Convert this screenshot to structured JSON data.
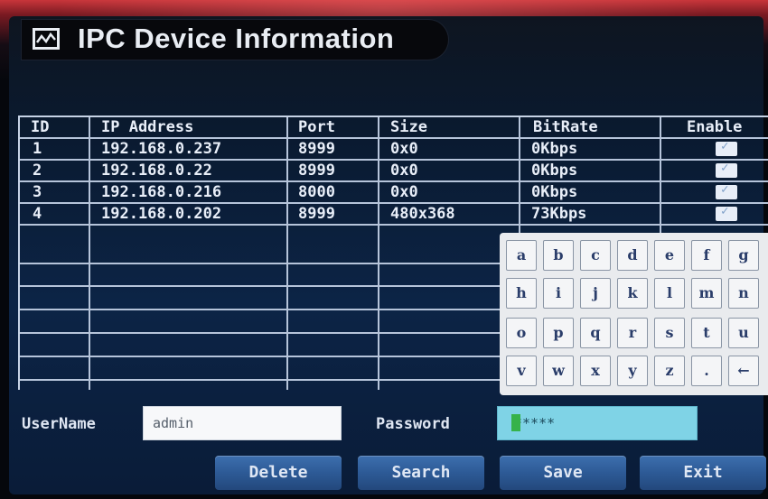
{
  "window": {
    "title": "IPC Device Information"
  },
  "table": {
    "columns": [
      "ID",
      "IP Address",
      "Port",
      "Size",
      "BitRate",
      "Enable"
    ],
    "rows": [
      {
        "id": "1",
        "ip": "192.168.0.237",
        "port": "8999",
        "size": "0x0",
        "bitrate": "0Kbps",
        "enabled": true
      },
      {
        "id": "2",
        "ip": "192.168.0.22",
        "port": "8999",
        "size": "0x0",
        "bitrate": "0Kbps",
        "enabled": true
      },
      {
        "id": "3",
        "ip": "192.168.0.216",
        "port": "8000",
        "size": "0x0",
        "bitrate": "0Kbps",
        "enabled": true
      },
      {
        "id": "4",
        "ip": "192.168.0.202",
        "port": "8999",
        "size": "480x368",
        "bitrate": "73Kbps",
        "enabled": true
      }
    ]
  },
  "keyboard": {
    "keys": [
      [
        "a",
        "b",
        "c",
        "d",
        "e",
        "f",
        "g"
      ],
      [
        "h",
        "i",
        "j",
        "k",
        "l",
        "m",
        "n"
      ],
      [
        "o",
        "p",
        "q",
        "r",
        "s",
        "t",
        "u"
      ],
      [
        "v",
        "w",
        "x",
        "y",
        "z",
        ".",
        "←"
      ]
    ]
  },
  "login": {
    "username_label": "UserName",
    "username_value": "admin",
    "password_label": "Password",
    "password_value": "*****"
  },
  "buttons": {
    "delete": "Delete",
    "search": "Search",
    "save": "Save",
    "exit": "Exit"
  },
  "icons": {
    "title": "chart-icon",
    "backspace": "backspace-icon",
    "check": "check-icon"
  },
  "colors": {
    "button": "#2d5a96",
    "password_bg": "#7fd3e6",
    "cursor": "#36b24a",
    "grid": "#b6c4da"
  }
}
